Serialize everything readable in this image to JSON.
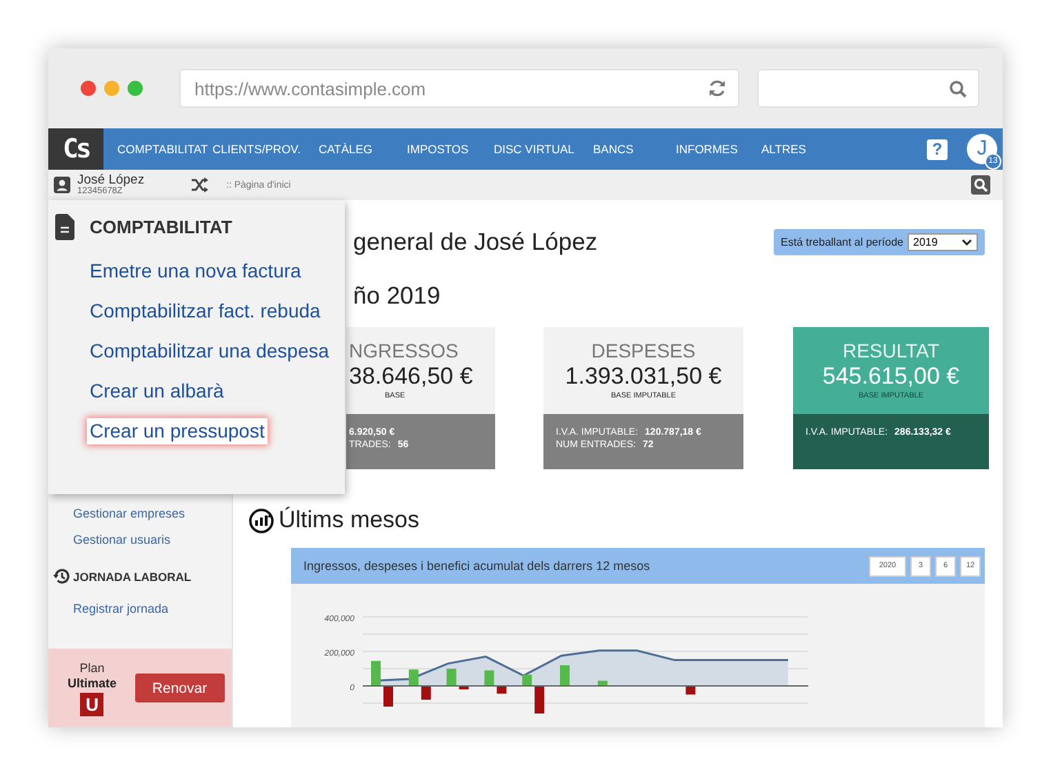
{
  "browser": {
    "url": "https://www.contasimple.com"
  },
  "nav": {
    "logo": "Cs",
    "items": [
      "COMPTABILITAT",
      "CLIENTS/PROV.",
      "CATÀLEG",
      "IMPOSTOS",
      "DISC VIRTUAL",
      "BANCS",
      "INFORMES",
      "ALTRES"
    ],
    "help": "?",
    "avatar": "J",
    "avatar_badge": "13"
  },
  "user": {
    "name": "José López",
    "tax_id": "12345678Z"
  },
  "breadcrumb": ":: Pàgina d'inici",
  "menu": {
    "title": "COMPTABILITAT",
    "items": [
      {
        "label": "Emetre una nova factura",
        "selected": false
      },
      {
        "label": "Comptabilitzar fact. rebuda",
        "selected": false
      },
      {
        "label": "Comptabilitzar una despesa",
        "selected": false
      },
      {
        "label": "Crear un albarà",
        "selected": false
      },
      {
        "label": "Crear un pressupost",
        "selected": true
      }
    ]
  },
  "sidebar": {
    "items": [
      {
        "kind": "link",
        "label": "Gestionar empreses"
      },
      {
        "kind": "link",
        "label": "Gestionar usuaris"
      },
      {
        "kind": "header",
        "label": "JORNADA LABORAL"
      },
      {
        "kind": "link",
        "label": "Registrar jornada"
      }
    ],
    "plan": {
      "label": "Plan",
      "name": "Ultimate",
      "badge": "U",
      "button": "Renovar"
    }
  },
  "page": {
    "title": "general de José López",
    "period": {
      "label": "Está treballant al període",
      "value": "2019"
    },
    "year_heading": "ño 2019"
  },
  "cards": [
    {
      "kind": "neutral",
      "title": "NGRESSOS",
      "amount": "38.646,50 €",
      "caption": "BASE",
      "details": [
        {
          "value": "6.920,50 €"
        },
        {
          "label": "TRADES:",
          "value": "56"
        }
      ]
    },
    {
      "kind": "neutral",
      "title": "DESPESES",
      "amount": "1.393.031,50 €",
      "caption": "BASE IMPUTABLE",
      "details": [
        {
          "label": "I.V.A. IMPUTABLE:",
          "value": "120.787,18 €"
        },
        {
          "label": "NUM ENTRADES:",
          "value": "72"
        }
      ]
    },
    {
      "kind": "positive",
      "title": "RESULTAT",
      "amount": "545.615,00 €",
      "caption": "BASE IMPUTABLE",
      "details": [
        {
          "label": "I.V.A. IMPUTABLE:",
          "value": "286.133,32 €"
        }
      ]
    }
  ],
  "recent": {
    "title": "Últims mesos",
    "panel": {
      "title": "Ingressos, despeses i benefici acumulat dels darrers 12 mesos",
      "ranges": [
        "2020",
        "3",
        "6",
        "12"
      ],
      "chart_data": {
        "type": "bar",
        "ylim": [
          -160000,
          400000
        ],
        "yticks": [
          {
            "value": 0,
            "label": "0"
          },
          {
            "value": 200000,
            "label": "200,000"
          },
          {
            "value": 400000,
            "label": "400,000"
          }
        ],
        "series": [
          {
            "type": "area",
            "color": "#4d6f95",
            "values": [
              30000,
              40000,
              130000,
              170000,
              60000,
              175000,
              205000,
              205000,
              150000,
              150000,
              150000,
              150000
            ]
          },
          {
            "color": "#55b94b",
            "values": [
              145000,
              95000,
              100000,
              90000,
              65000,
              120000,
              30000,
              0,
              0,
              0,
              0,
              0
            ]
          },
          {
            "color": "#a30f0f",
            "values": [
              -120000,
              -80000,
              -20000,
              -45000,
              -160000,
              0,
              0,
              0,
              -50000,
              0,
              0,
              0
            ]
          }
        ]
      }
    }
  }
}
